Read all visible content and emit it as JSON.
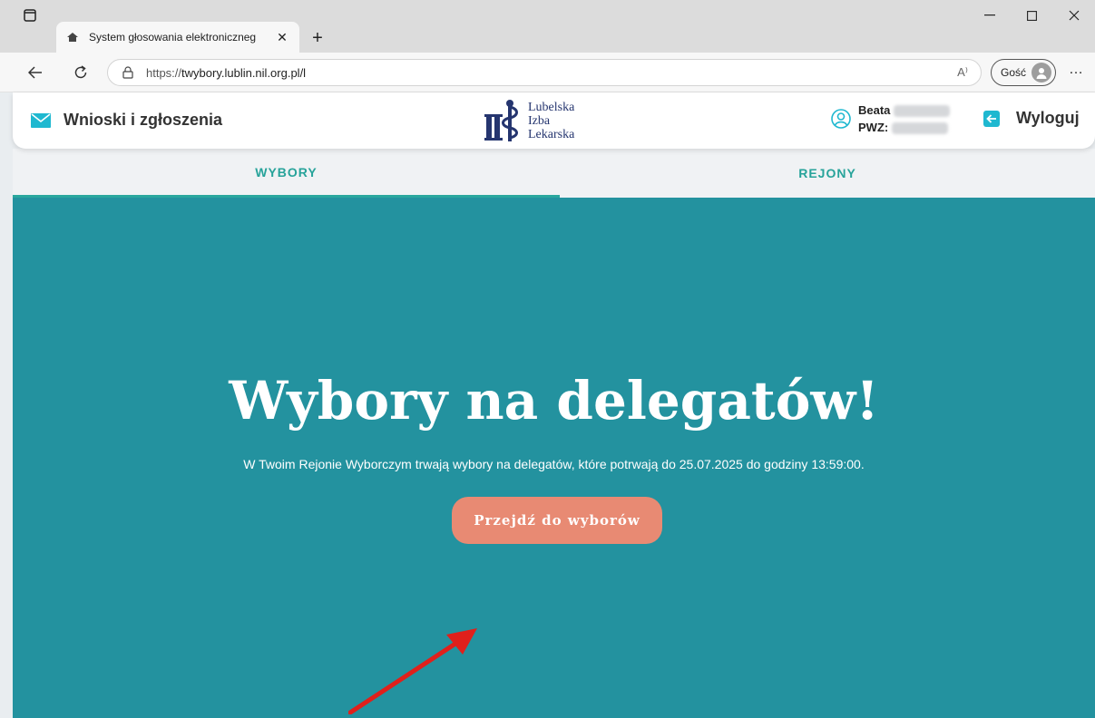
{
  "browser": {
    "tab_title": "System głosowania elektroniczneg",
    "tab_close": "✕",
    "new_tab": "+",
    "url_proto": "https://",
    "url_host": "twybory.lublin.nil.org.pl/l",
    "read_aloud": "A⁾",
    "guest_label": "Gość",
    "more": "…"
  },
  "header": {
    "requests_label": "Wnioski i zgłoszenia",
    "logo_lines": [
      "Lubelska",
      "Izba",
      "Lekarska"
    ],
    "user_first_name": "Beata",
    "pwz_label": "PWZ:",
    "logout_label": "Wyloguj"
  },
  "tabs": [
    {
      "label": "WYBORY",
      "active": true
    },
    {
      "label": "REJONY",
      "active": false
    }
  ],
  "hero": {
    "title": "Wybory na delegatów!",
    "subtitle": "W Twoim Rejonie Wyborczym trwają wybory na delegatów, które potrwają do 25.07.2025 do godziny 13:59:00.",
    "button_label": "Przejdź do wyborów"
  },
  "colors": {
    "hero_bg": "#23929f",
    "button_bg": "#e88a73",
    "tab_text": "#27a39a",
    "accent_icon": "#1fb8d0",
    "logo_blue": "#25356f",
    "arrow": "#e0201b"
  }
}
